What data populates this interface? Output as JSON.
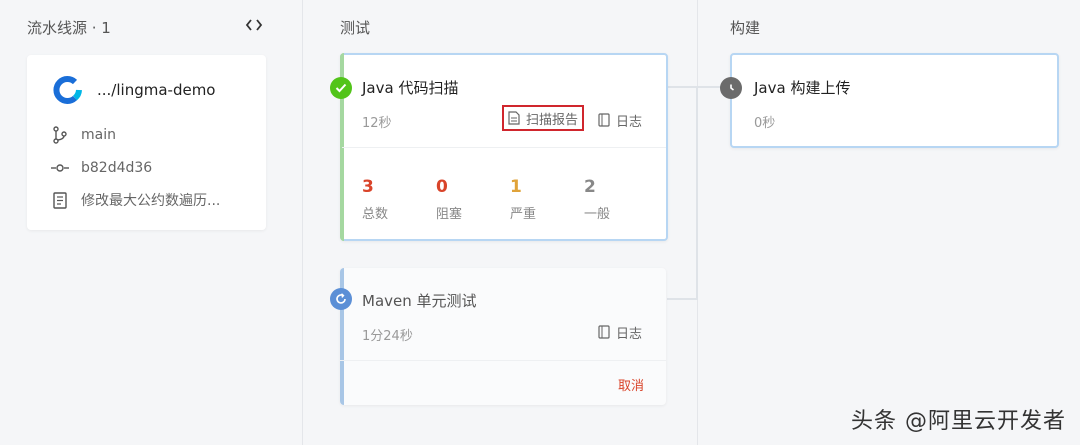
{
  "columns": {
    "source": {
      "title": "流水线源 · 1"
    },
    "test": {
      "title": "测试"
    },
    "build": {
      "title": "构建"
    }
  },
  "source_card": {
    "repo": ".../lingma-demo",
    "branch": "main",
    "commit": "b82d4d36",
    "message": "修改最大公约数遍历..."
  },
  "jobs": {
    "java_scan": {
      "title": "Java 代码扫描",
      "duration": "12秒",
      "status": "success",
      "report_label": "扫描报告",
      "log_label": "日志",
      "stats": [
        {
          "value": "3",
          "label": "总数",
          "color": "#d9442a"
        },
        {
          "value": "0",
          "label": "阻塞",
          "color": "#d9442a"
        },
        {
          "value": "1",
          "label": "严重",
          "color": "#e0a33a"
        },
        {
          "value": "2",
          "label": "一般",
          "color": "#888888"
        }
      ]
    },
    "maven_test": {
      "title": "Maven 单元测试",
      "duration": "1分24秒",
      "status": "running",
      "log_label": "日志",
      "cancel_label": "取消"
    },
    "java_build": {
      "title": "Java 构建上传",
      "duration": "0秒",
      "status": "waiting"
    }
  },
  "watermark": "头条 @阿里云开发者",
  "colors": {
    "success": "#52c41a",
    "running": "#5b8fd6",
    "waiting": "#6b6b6b",
    "highlight": "#d0262d",
    "cancel": "#d9442a"
  }
}
